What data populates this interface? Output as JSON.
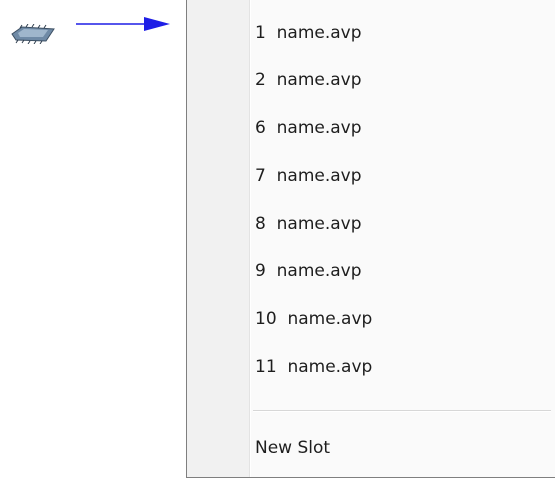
{
  "menu": {
    "items": [
      {
        "label": "1  name.avp"
      },
      {
        "label": "2  name.avp"
      },
      {
        "label": "6  name.avp"
      },
      {
        "label": "7  name.avp"
      },
      {
        "label": "8  name.avp"
      },
      {
        "label": "9  name.avp"
      },
      {
        "label": "10  name.avp"
      },
      {
        "label": "11  name.avp"
      }
    ],
    "new_slot_label": "New Slot"
  },
  "icons": {
    "source": "chip-icon",
    "pointer": "arrow-right-icon"
  },
  "colors": {
    "arrow": "#1e1ee6",
    "menu_border": "#7f7f7f",
    "menu_background": "#fafafa",
    "gutter_background": "#f1f1f1"
  }
}
